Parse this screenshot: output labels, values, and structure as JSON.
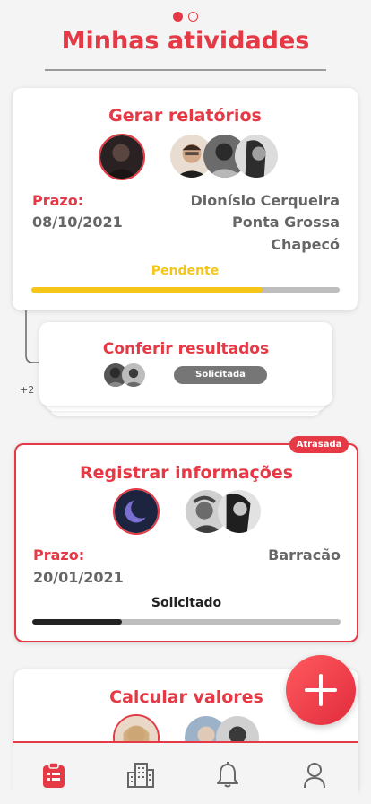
{
  "header": {
    "title": "Minhas atividades"
  },
  "pager": {
    "pages": 2,
    "active": 0
  },
  "cards": [
    {
      "title": "Gerar relatórios",
      "deadline_label": "Prazo:",
      "deadline": "08/10/2021",
      "locations": [
        "Dionísio Cerqueira",
        "Ponta Grossa",
        "Chapecó"
      ],
      "status": "Pendente",
      "progress": 0.75,
      "progress_color": "#f5c518",
      "status_color": "#f5c518"
    },
    {
      "title": "Conferir resultados",
      "badge": "Solicitada",
      "more_count": "+2"
    },
    {
      "title": "Registrar informações",
      "tag": "Atrasada",
      "deadline_label": "Prazo:",
      "deadline": "20/01/2021",
      "locations": [
        "Barracão"
      ],
      "status": "Solicitado",
      "progress": 0.29,
      "progress_color": "#222222",
      "status_color": "#222222"
    },
    {
      "title": "Calcular valores"
    }
  ],
  "nav": {
    "items": [
      "clipboard-icon",
      "building-icon",
      "bell-icon",
      "user-icon"
    ],
    "active": 0
  },
  "colors": {
    "accent": "#e53945",
    "pending": "#f5c518"
  }
}
